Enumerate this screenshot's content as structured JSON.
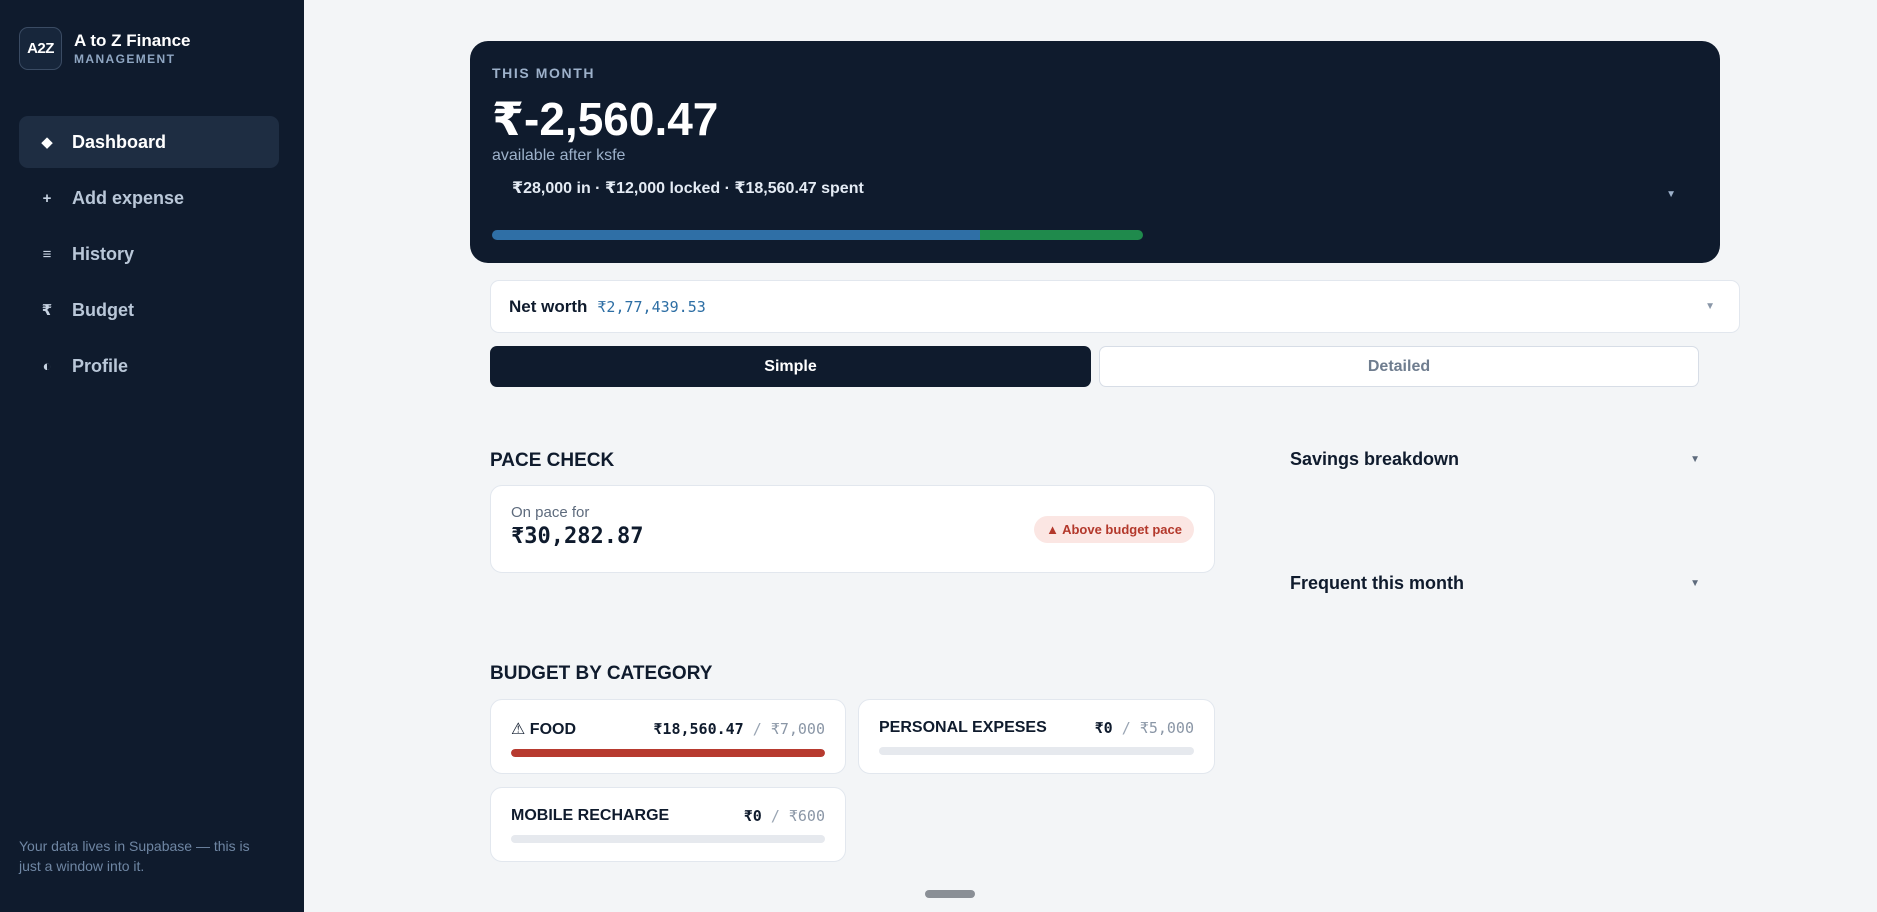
{
  "brand": {
    "logo_text": "A2Z",
    "title": "A to Z Finance",
    "subtitle": "MANAGEMENT"
  },
  "nav": [
    {
      "label": "Dashboard",
      "icon": "diamond-icon",
      "glyph": "◆",
      "active": true
    },
    {
      "label": "Add expense",
      "icon": "plus-icon",
      "glyph": "+",
      "active": false
    },
    {
      "label": "History",
      "icon": "list-icon",
      "glyph": "≡",
      "active": false
    },
    {
      "label": "Budget",
      "icon": "rupee-icon",
      "glyph": "₹",
      "active": false
    },
    {
      "label": "Profile",
      "icon": "half-circle-icon",
      "glyph": "◐",
      "active": false
    }
  ],
  "sidebar_footer": "Your data lives in Supabase — this is just a window into it.",
  "hero": {
    "eyebrow": "THIS MONTH",
    "amount": "₹-2,560.47",
    "sub": "available after ksfe",
    "breakdown": "₹28,000 in · ₹12,000 locked · ₹18,560.47 spent",
    "progress": {
      "locked_fraction": 0.4286,
      "spent_fraction": 0.2143
    },
    "colors": {
      "locked": "#2f6fa6",
      "spent": "#1f8a4c"
    }
  },
  "networth": {
    "label": "Net worth",
    "value": "₹2,77,439.53"
  },
  "view_toggle": {
    "simple": "Simple",
    "detailed": "Detailed",
    "selected": "Simple"
  },
  "pace": {
    "title": "PACE CHECK",
    "label": "On pace for",
    "value": "₹30,282.87",
    "badge": "▲ Above budget pace"
  },
  "panels": {
    "savings": "Savings breakdown",
    "frequent": "Frequent this month"
  },
  "budget": {
    "title": "BUDGET BY CATEGORY",
    "categories": [
      {
        "name": "⚠ FOOD",
        "spent": "₹18,560.47",
        "limit": "₹7,000",
        "fill": 1.0
      },
      {
        "name": "PERSONAL EXPESES",
        "spent": "₹0",
        "limit": "₹5,000",
        "fill": 0
      },
      {
        "name": "MOBILE RECHARGE",
        "spent": "₹0",
        "limit": "₹600",
        "fill": 0
      }
    ],
    "over_color": "#b73a2f"
  }
}
